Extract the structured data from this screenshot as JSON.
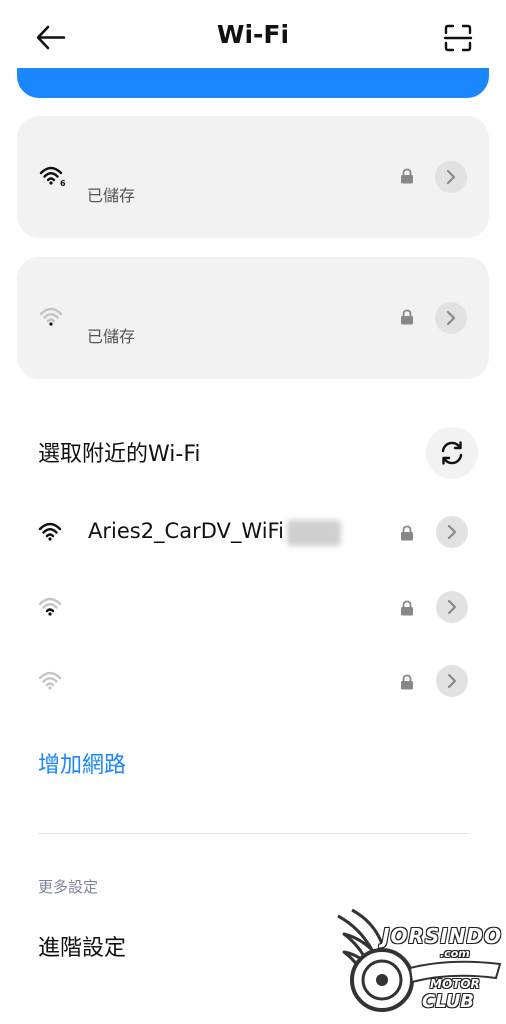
{
  "header": {
    "title": "Wi-Fi",
    "back_icon": "arrow-left-icon",
    "scan_icon": "qr-scan-icon"
  },
  "accent_color": "#1a87ff",
  "saved_networks": [
    {
      "status": "已儲存",
      "wifi_icon": "wifi-6-strong-icon",
      "secured": true
    },
    {
      "status": "已儲存",
      "wifi_icon": "wifi-weak-icon",
      "secured": true
    }
  ],
  "nearby": {
    "title": "選取附近的Wi-Fi",
    "refresh_icon": "refresh-icon",
    "networks": [
      {
        "ssid": "Aries2_CarDV_WiFi",
        "wifi_icon": "wifi-strong-icon",
        "secured": true
      },
      {
        "ssid": "",
        "wifi_icon": "wifi-medium-icon",
        "secured": true
      },
      {
        "ssid": "",
        "wifi_icon": "wifi-weak-icon",
        "secured": true
      }
    ]
  },
  "add_network_label": "增加網路",
  "more_settings": {
    "section_label": "更多設定",
    "advanced_label": "進階設定"
  },
  "watermark": {
    "line1": "JORSINDO",
    "line2": ".com",
    "line3": "MOTOR",
    "line4": "CLUB"
  }
}
